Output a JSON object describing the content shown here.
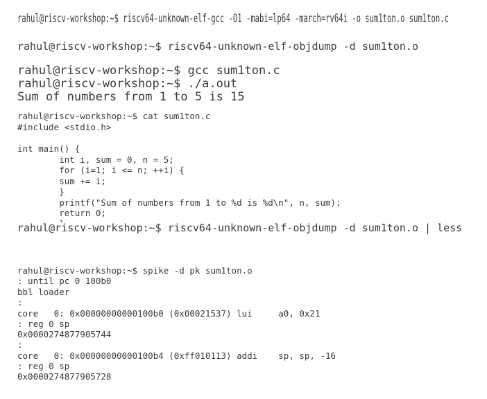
{
  "snippet_1": {
    "command_line": "rahul@riscv-workshop:~$ riscv64-unknown-elf-gcc -O1 -mabi=lp64 -march=rv64i -o sum1ton.o sum1ton.c"
  },
  "snippet_2": {
    "command_line": "rahul@riscv-workshop:~$ riscv64-unknown-elf-objdump -d sum1ton.o"
  },
  "snippet_3": {
    "lines": [
      "rahul@riscv-workshop:~$ gcc sum1ton.c",
      "rahul@riscv-workshop:~$ ./a.out",
      "Sum of numbers from 1 to 5 is 15"
    ]
  },
  "snippet_4": {
    "lines": [
      "rahul@riscv-workshop:~$ cat sum1ton.c",
      "#include <stdio.h>",
      "",
      "int main() {",
      "        int i, sum = 0, n = 5;",
      "        for (i=1; i <= n; ++i) {",
      "        sum += i;",
      "        }",
      "        printf(\"Sum of numbers from 1 to %d is %d\\n\", n, sum);",
      "        return 0;",
      "        }"
    ]
  },
  "snippet_5": {
    "command_line": "rahul@riscv-workshop:~$ riscv64-unknown-elf-objdump -d sum1ton.o | less"
  },
  "snippet_6": {
    "lines": [
      "rahul@riscv-workshop:~$ spike -d pk sum1ton.o",
      ": until pc 0 100b0",
      "bbl loader",
      ":",
      "core   0: 0x00000000000100b0 (0x00021537) lui     a0, 0x21",
      ": reg 0 sp",
      "0x0000274877905744",
      ":",
      "core   0: 0x00000000000100b4 (0xff010113) addi    sp, sp, -16",
      ": reg 0 sp",
      "0x0000274877905728"
    ]
  }
}
